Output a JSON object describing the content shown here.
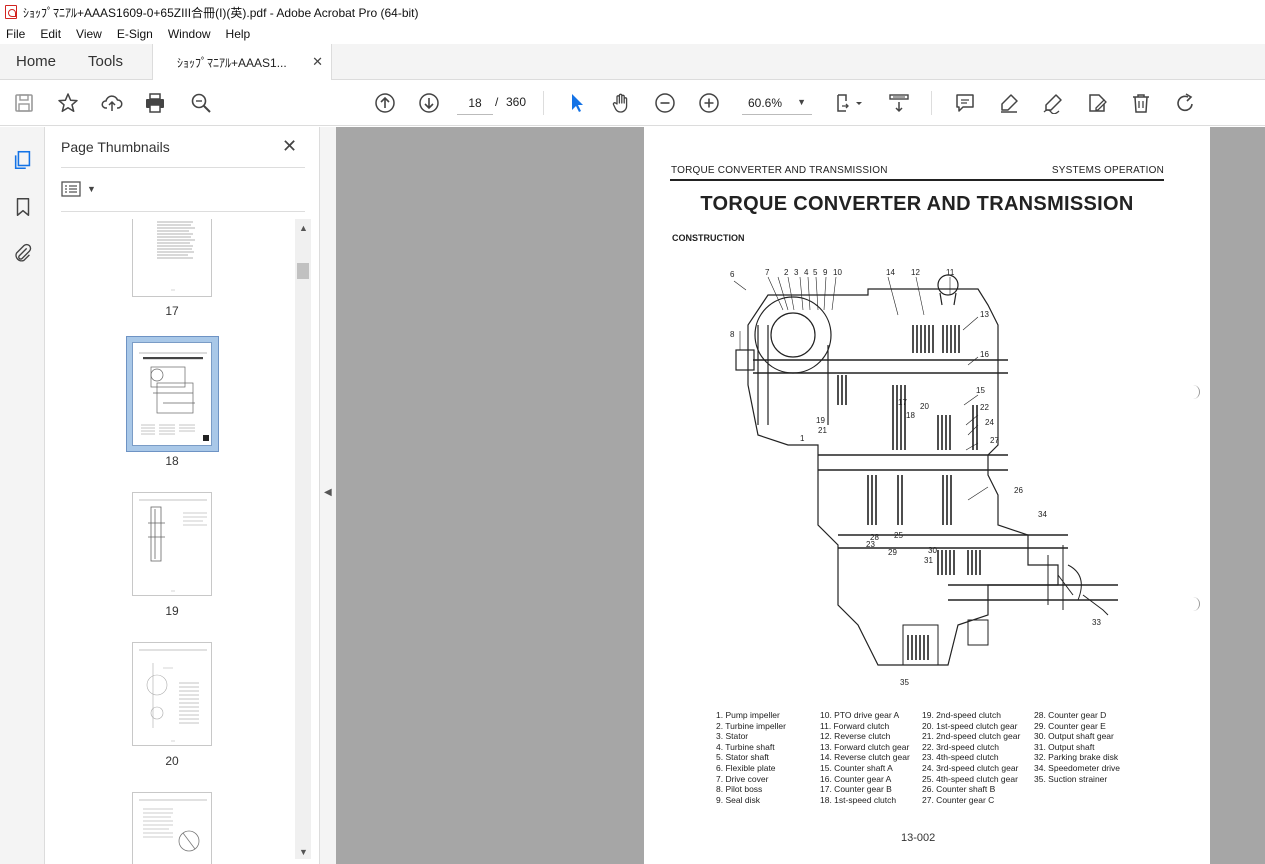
{
  "window": {
    "title": "ｼｮｯﾌﾟﾏﾆｱﾙ+AAAS1609-0+65ZIII合冊(I)(英).pdf - Adobe Acrobat Pro (64-bit)"
  },
  "menu": [
    "File",
    "Edit",
    "View",
    "E-Sign",
    "Window",
    "Help"
  ],
  "tabs": {
    "home": "Home",
    "tools": "Tools",
    "document": "ｼｮｯﾌﾟﾏﾆｱﾙ+AAAS1...",
    "close_glyph": "✕"
  },
  "toolbar": {
    "current_page": "18",
    "page_sep": "/",
    "total_pages": "360",
    "zoom": "60.6%",
    "icons": [
      "save-icon",
      "bookmark-star-icon",
      "upload-icon",
      "print-icon",
      "find-zoom-icon",
      "page-up-icon",
      "page-down-icon",
      "select-arrow-icon",
      "hand-icon",
      "zoom-out-icon",
      "zoom-in-icon",
      "page-fit-icon",
      "scroll-mode-icon",
      "comment-icon",
      "highlight-icon",
      "sign-icon",
      "edit-icon",
      "delete-icon",
      "rotate-icon"
    ]
  },
  "panel": {
    "title": "Page Thumbnails",
    "thumbnails": [
      {
        "label": "17"
      },
      {
        "label": "18",
        "selected": true
      },
      {
        "label": "19"
      },
      {
        "label": "20"
      }
    ]
  },
  "document": {
    "header_left": "TORQUE CONVERTER AND TRANSMISSION",
    "header_right": "SYSTEMS OPERATION",
    "title": "TORQUE CONVERTER AND TRANSMISSION",
    "section": "CONSTRUCTION",
    "page_number": "13-002",
    "legend": [
      [
        "1.  Pump impeller",
        "2.  Turbine impeller",
        "3.  Stator",
        "4.  Turbine shaft",
        "5.  Stator shaft",
        "6.  Flexible plate",
        "7.  Drive cover",
        "8.  Pilot boss",
        "9.  Seal disk"
      ],
      [
        "10. PTO drive gear A",
        "11. Forward clutch",
        "12. Reverse clutch",
        "13. Forward clutch gear",
        "14. Reverse clutch gear",
        "15. Counter shaft A",
        "16. Counter gear A",
        "17. Counter gear B",
        "18. 1st-speed clutch"
      ],
      [
        "19. 2nd-speed clutch",
        "20. 1st-speed clutch gear",
        "21. 2nd-speed clutch gear",
        "22. 3rd-speed clutch",
        "23. 4th-speed clutch",
        "24. 3rd-speed clutch gear",
        "25. 4th-speed clutch gear",
        "26. Counter shaft B",
        "27. Counter gear C"
      ],
      [
        "28. Counter gear D",
        "29. Counter gear E",
        "30. Output shaft gear",
        "31. Output shaft",
        "32. Parking brake disk",
        "34. Speedometer drive",
        "35. Suction strainer"
      ]
    ],
    "callouts": [
      "6",
      "7",
      "2",
      "3",
      "4",
      "5",
      "9",
      "10",
      "14",
      "12",
      "11",
      "13",
      "8",
      "16",
      "15",
      "22",
      "24",
      "27",
      "17",
      "20",
      "18",
      "19",
      "21",
      "1",
      "26",
      "34",
      "28",
      "25",
      "23",
      "29",
      "30",
      "31",
      "33",
      "35"
    ]
  },
  "colors": {
    "accent": "#1473e6",
    "selected_thumb": "#a9c8e8",
    "doc_background": "#a6a6a6"
  }
}
